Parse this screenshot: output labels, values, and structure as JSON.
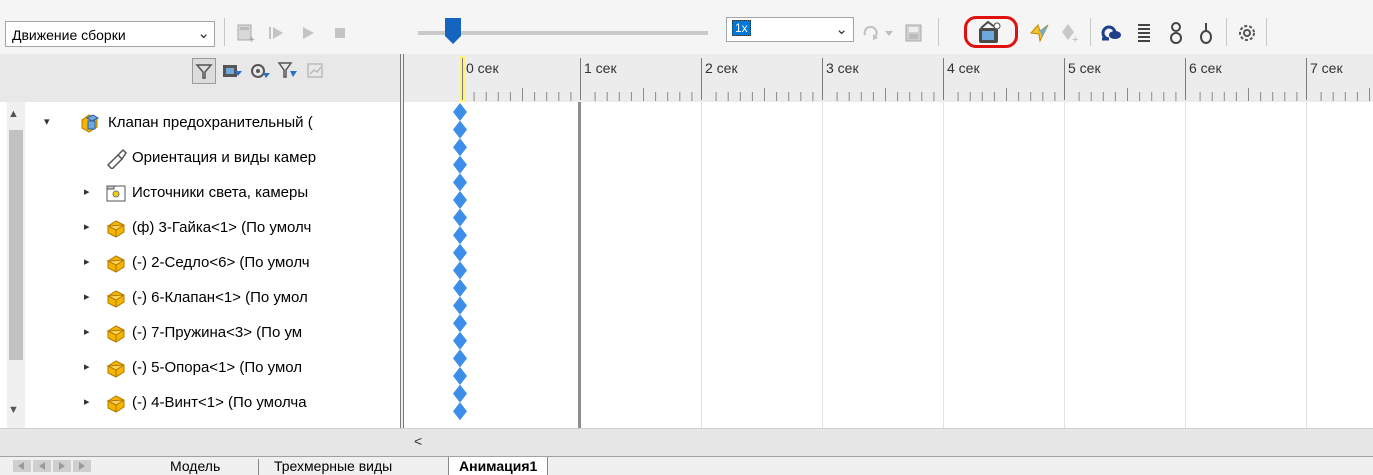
{
  "toolbar": {
    "study_type": "Движение сборки",
    "speed": "1x",
    "colors": {
      "slider_thumb": "#1565c0",
      "highlight": "#e01010"
    },
    "icons": [
      "calculate-icon",
      "play-from-start-icon",
      "play-icon",
      "stop-icon",
      "playback-mode-icon",
      "save-animation-icon",
      "animation-wizard-icon",
      "autokey-icon",
      "add-key-icon",
      "motor-icon",
      "spring-icon",
      "contact-icon",
      "gravity-icon",
      "properties-icon"
    ]
  },
  "filter_icons": [
    "filter-icon",
    "filter-animated-icon",
    "filter-driving-icon",
    "filter-selected-icon",
    "filter-results-icon"
  ],
  "timeline": {
    "tick_labels": [
      "0 сек",
      "1 сек",
      "2 сек",
      "3 сек",
      "4 сек",
      "5 сек",
      "6 сек",
      "7 сек"
    ]
  },
  "tree": {
    "items": [
      {
        "label": "Клапан предохранительный  (",
        "icon": "assembly-icon",
        "expander": "▾"
      },
      {
        "label": "Ориентация и виды камер",
        "icon": "camera-icon",
        "expander": ""
      },
      {
        "label": "Источники света, камеры",
        "icon": "lights-folder-icon",
        "expander": "▸"
      },
      {
        "label": "(ф) 3-Гайка<1> (По умолч",
        "icon": "part-icon",
        "expander": "▸"
      },
      {
        "label": "(-) 2-Седло<6> (По умолч",
        "icon": "part-icon",
        "expander": "▸"
      },
      {
        "label": "(-) 6-Клапан<1> (По умол",
        "icon": "part-icon",
        "expander": "▸"
      },
      {
        "label": "(-) 7-Пружина<3> (По ум",
        "icon": "part-icon",
        "expander": "▸"
      },
      {
        "label": "(-) 5-Опора<1> (По умол",
        "icon": "part-icon",
        "expander": "▸"
      },
      {
        "label": "(-) 4-Винт<1> (По умолча",
        "icon": "part-icon",
        "expander": "▸"
      }
    ]
  },
  "scroll_left_glyph": "<",
  "tabs": [
    "Модель",
    "Трехмерные виды",
    "Анимация1"
  ]
}
